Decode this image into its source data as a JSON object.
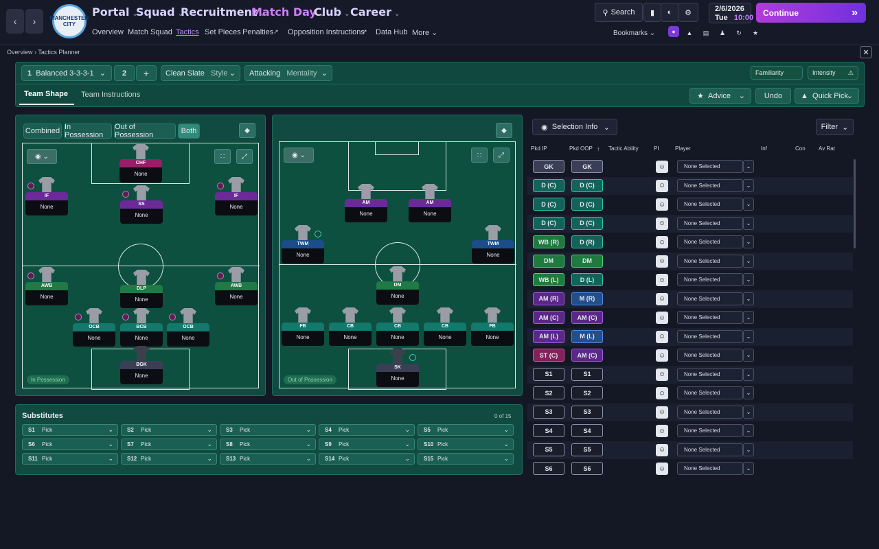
{
  "header": {
    "nav": [
      {
        "label": "Portal"
      },
      {
        "label": "Squad"
      },
      {
        "label": "Recruitment"
      },
      {
        "label": "Match Day"
      },
      {
        "label": "Club"
      },
      {
        "label": "Career"
      }
    ],
    "subnav": [
      "Overview",
      "Match Squad",
      "Tactics",
      "Set Pieces",
      "Penalties",
      "Opposition Instructions",
      "Data Hub",
      "More"
    ],
    "club_crest_text": "MANCHESTER CITY",
    "search_label": "Search",
    "bookmarks_label": "Bookmarks",
    "date": "2/6/2026",
    "day": "Tue",
    "time": "10:00",
    "continue_label": "Continue",
    "accent": "#b23bd9"
  },
  "breadcrumb": {
    "root": "Overview",
    "page": "Tactics Planner"
  },
  "tactic": {
    "slot": "1",
    "formation": "Balanced 3-3-3-1",
    "slot2": "2",
    "add": "+",
    "style_value": "Clean Slate",
    "style_label": "Style",
    "mentality_value": "Attacking",
    "mentality_label": "Mentality",
    "familiarity_label": "Familiarity",
    "intensity_label": "Intensity",
    "tabs": [
      "Team Shape",
      "Team Instructions"
    ],
    "advice_label": "Advice",
    "undo_label": "Undo",
    "quickpick_label": "Quick Pick"
  },
  "in_possession": {
    "filters": [
      "Combined",
      "In Possession",
      "Out of Possession",
      "Both"
    ],
    "label": "In Possession",
    "players": [
      {
        "role": "CHF",
        "name": "None"
      },
      {
        "role": "IF",
        "name": "None"
      },
      {
        "role": "SS",
        "name": "None"
      },
      {
        "role": "IF",
        "name": "None"
      },
      {
        "role": "AWB",
        "name": "None"
      },
      {
        "role": "DLP",
        "name": "None"
      },
      {
        "role": "AWB",
        "name": "None"
      },
      {
        "role": "OCB",
        "name": "None"
      },
      {
        "role": "BCB",
        "name": "None"
      },
      {
        "role": "OCB",
        "name": "None"
      },
      {
        "role": "BGK",
        "name": "None"
      }
    ]
  },
  "out_possession": {
    "label": "Out of Possession",
    "players": [
      {
        "role": "AM",
        "name": "None"
      },
      {
        "role": "AM",
        "name": "None"
      },
      {
        "role": "TWM",
        "name": "None"
      },
      {
        "role": "TWM",
        "name": "None"
      },
      {
        "role": "DM",
        "name": "None"
      },
      {
        "role": "FB",
        "name": "None"
      },
      {
        "role": "CB",
        "name": "None"
      },
      {
        "role": "CB",
        "name": "None"
      },
      {
        "role": "CB",
        "name": "None"
      },
      {
        "role": "FB",
        "name": "None"
      },
      {
        "role": "SK",
        "name": "None"
      }
    ]
  },
  "substitutes": {
    "title": "Substitutes",
    "count": "0 of 15",
    "slots": [
      {
        "id": "S1",
        "label": "Pick"
      },
      {
        "id": "S2",
        "label": "Pick"
      },
      {
        "id": "S3",
        "label": "Pick"
      },
      {
        "id": "S4",
        "label": "Pick"
      },
      {
        "id": "S5",
        "label": "Pick"
      },
      {
        "id": "S6",
        "label": "Pick"
      },
      {
        "id": "S7",
        "label": "Pick"
      },
      {
        "id": "S8",
        "label": "Pick"
      },
      {
        "id": "S9",
        "label": "Pick"
      },
      {
        "id": "S10",
        "label": "Pick"
      },
      {
        "id": "S11",
        "label": "Pick"
      },
      {
        "id": "S12",
        "label": "Pick"
      },
      {
        "id": "S13",
        "label": "Pick"
      },
      {
        "id": "S14",
        "label": "Pick"
      },
      {
        "id": "S15",
        "label": "Pick"
      }
    ]
  },
  "selection": {
    "title": "Selection Info",
    "filter": "Filter",
    "headers": [
      "Pkd IP",
      "Pkd OOP",
      "Tactic Ability",
      "PI",
      "Player",
      "Inf",
      "Con",
      "Av Rat"
    ],
    "rows": [
      {
        "ip": "GK",
        "oop": "GK",
        "player": "None Selected"
      },
      {
        "ip": "D (C)",
        "oop": "D (C)",
        "player": "None Selected"
      },
      {
        "ip": "D (C)",
        "oop": "D (C)",
        "player": "None Selected"
      },
      {
        "ip": "D (C)",
        "oop": "D (C)",
        "player": "None Selected"
      },
      {
        "ip": "WB (R)",
        "oop": "D (R)",
        "player": "None Selected"
      },
      {
        "ip": "DM",
        "oop": "DM",
        "player": "None Selected"
      },
      {
        "ip": "WB (L)",
        "oop": "D (L)",
        "player": "None Selected"
      },
      {
        "ip": "AM (R)",
        "oop": "M (R)",
        "player": "None Selected"
      },
      {
        "ip": "AM (C)",
        "oop": "AM (C)",
        "player": "None Selected"
      },
      {
        "ip": "AM (L)",
        "oop": "M (L)",
        "player": "None Selected"
      },
      {
        "ip": "ST (C)",
        "oop": "AM (C)",
        "player": "None Selected"
      },
      {
        "ip": "S1",
        "oop": "S1",
        "player": "None Selected"
      },
      {
        "ip": "S2",
        "oop": "S2",
        "player": "None Selected"
      },
      {
        "ip": "S3",
        "oop": "S3",
        "player": "None Selected"
      },
      {
        "ip": "S4",
        "oop": "S4",
        "player": "None Selected"
      },
      {
        "ip": "S5",
        "oop": "S5",
        "player": "None Selected"
      },
      {
        "ip": "S6",
        "oop": "S6",
        "player": "None Selected"
      }
    ]
  }
}
